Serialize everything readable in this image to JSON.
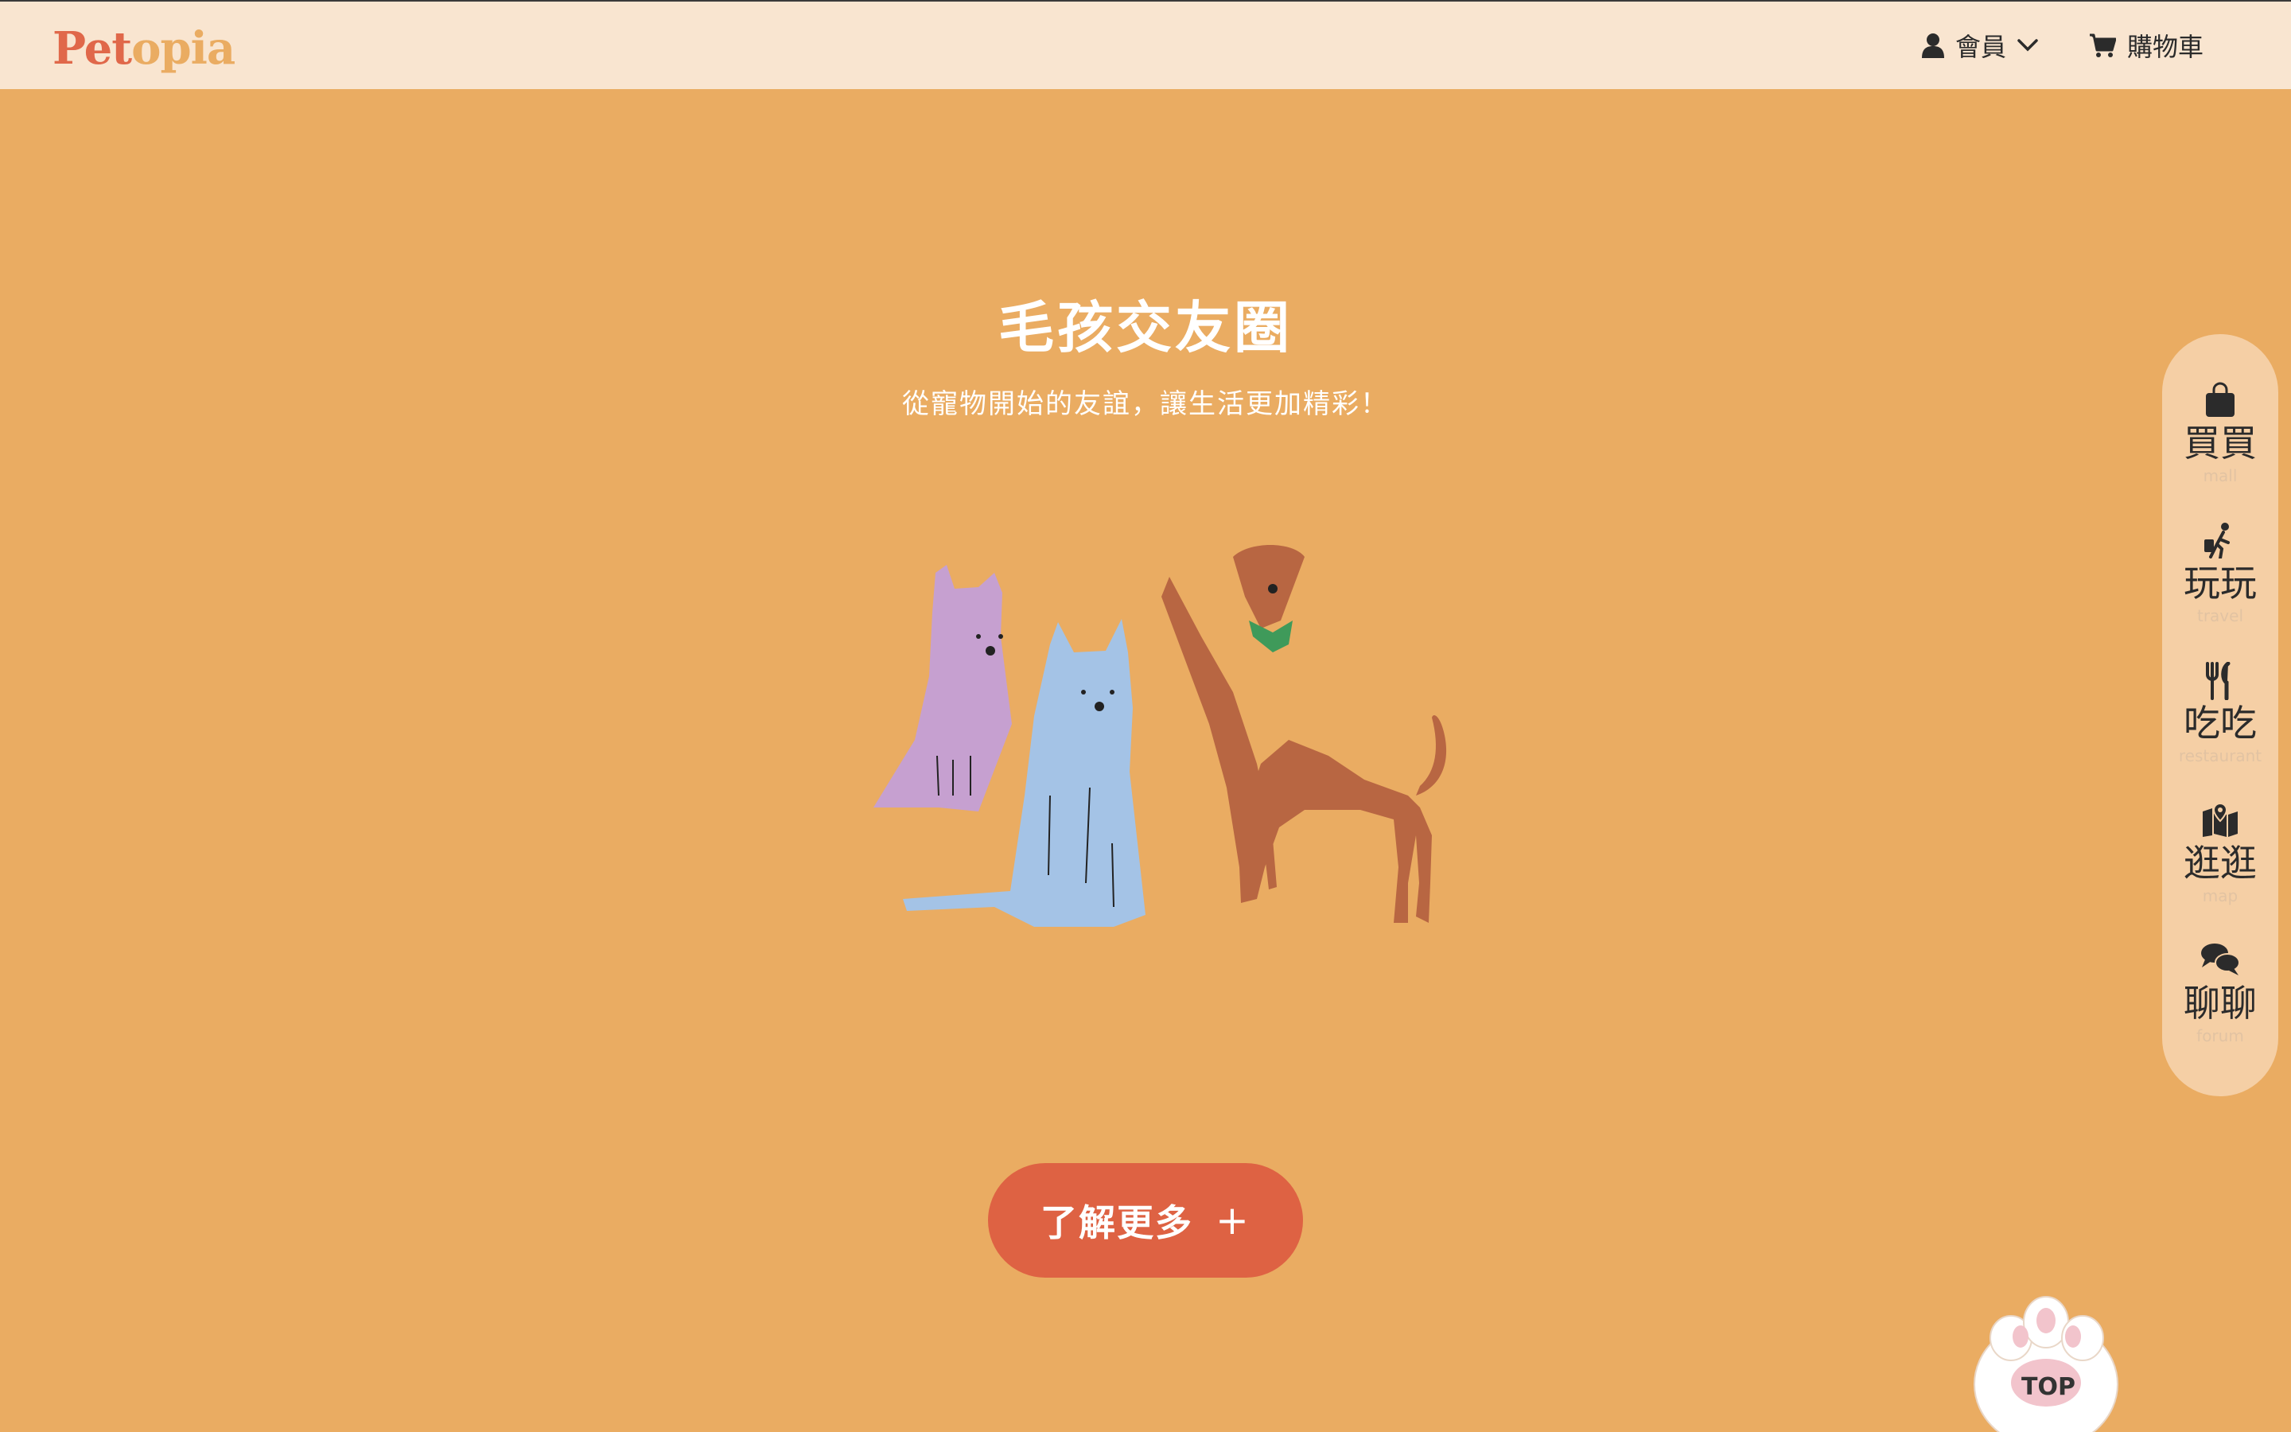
{
  "header": {
    "logo_part1": "Pet",
    "logo_part2": "opia",
    "member_label": "會員",
    "cart_label": "購物車"
  },
  "hero": {
    "title": "毛孩交友圈",
    "subtitle": "從寵物開始的友誼，讓生活更加精彩！",
    "cta_label": "了解更多",
    "cta_icon": "+"
  },
  "sidebar": {
    "items": [
      {
        "zh": "買買",
        "en": "mall",
        "icon": "shopping-bag-icon"
      },
      {
        "zh": "玩玩",
        "en": "travel",
        "icon": "luggage-walk-icon"
      },
      {
        "zh": "吃吃",
        "en": "restaurant",
        "icon": "utensils-icon"
      },
      {
        "zh": "逛逛",
        "en": "map",
        "icon": "map-pin-icon"
      },
      {
        "zh": "聊聊",
        "en": "forum",
        "icon": "chat-bubbles-icon"
      }
    ]
  },
  "top_button": {
    "label": "TOP"
  },
  "colors": {
    "background": "#EAAC62",
    "header": "#F9E5D0",
    "accent": "#DE6243",
    "sidebar": "#F5CFA5"
  }
}
